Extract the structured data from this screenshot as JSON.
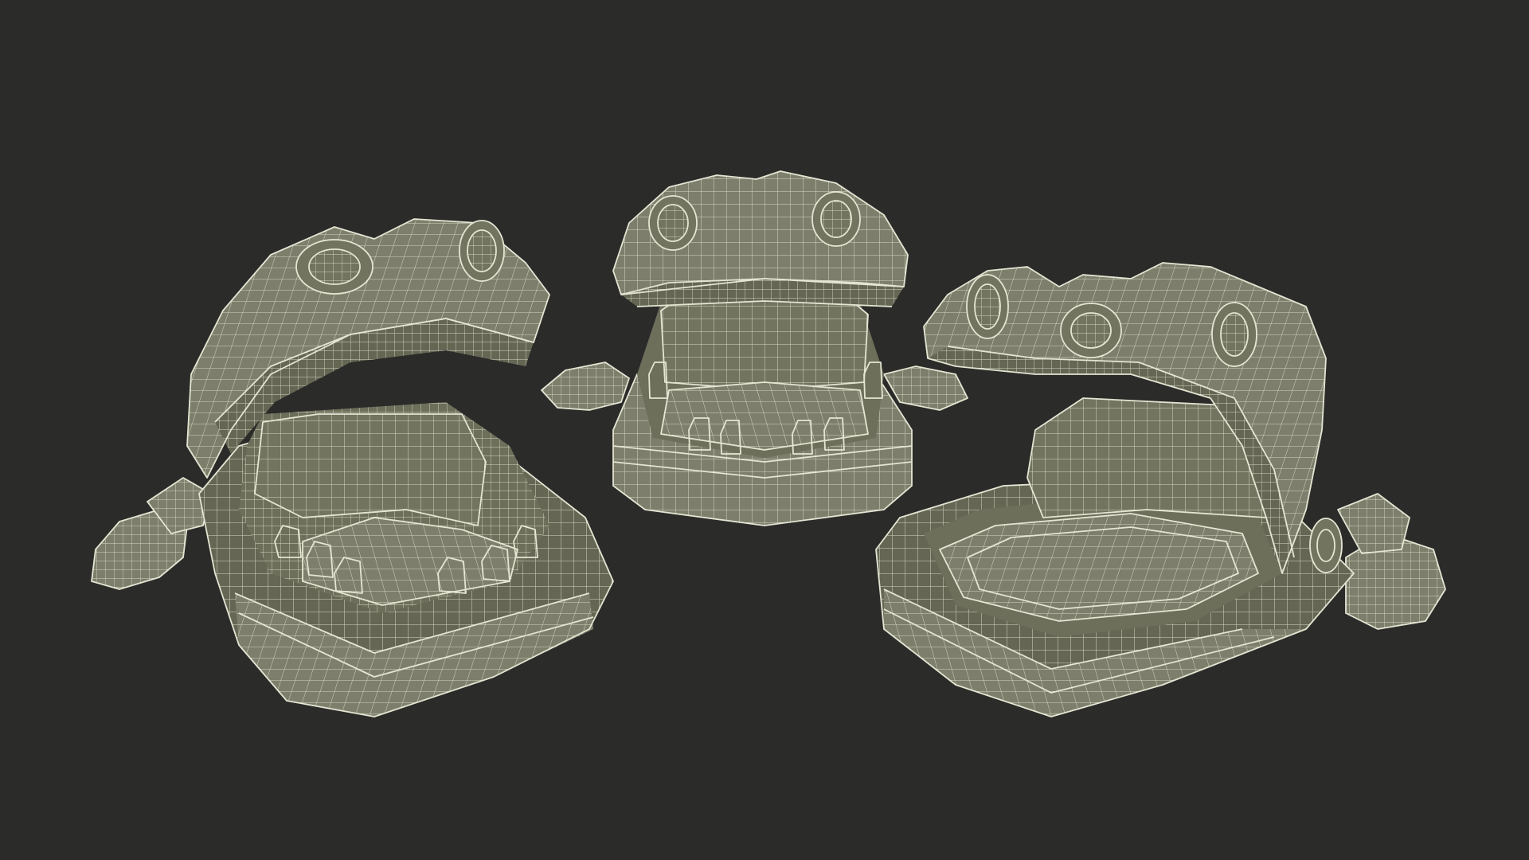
{
  "scene": {
    "background_color": "#2b2b2a",
    "mesh_fill_color": "#7d7f6c",
    "wire_color": "#d6d7c3",
    "models": [
      {
        "name": "frog-model-left"
      },
      {
        "name": "frog-model-center"
      },
      {
        "name": "frog-model-right"
      }
    ]
  }
}
